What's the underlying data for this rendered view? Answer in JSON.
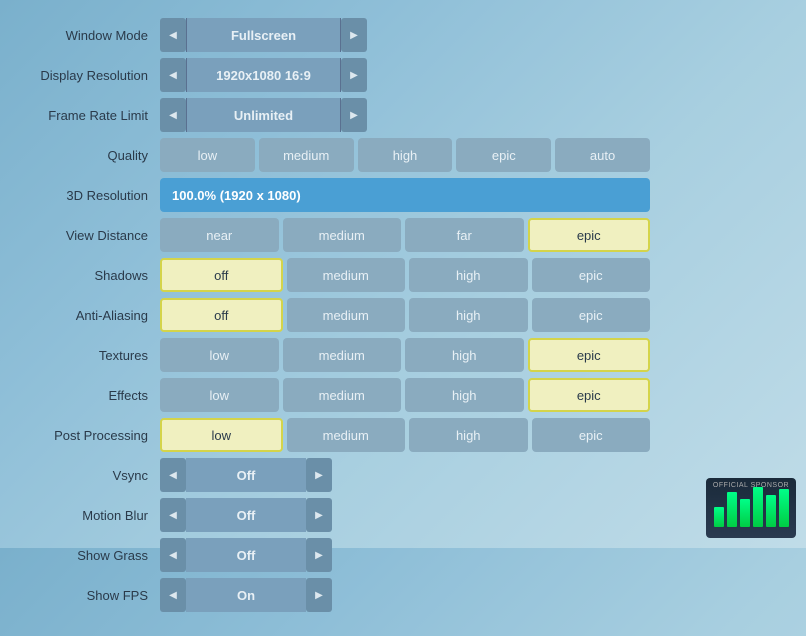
{
  "rows": {
    "window_mode": {
      "label": "Window Mode",
      "value": "Fullscreen"
    },
    "display_resolution": {
      "label": "Display Resolution",
      "value": "1920x1080 16:9"
    },
    "frame_rate_limit": {
      "label": "Frame Rate Limit",
      "value": "Unlimited"
    },
    "quality": {
      "label": "Quality",
      "buttons": [
        "low",
        "medium",
        "high",
        "epic",
        "auto"
      ]
    },
    "resolution_3d": {
      "label": "3D Resolution",
      "value": "100.0%  (1920 x 1080)"
    },
    "view_distance": {
      "label": "View Distance",
      "buttons": [
        "near",
        "medium",
        "far",
        "epic"
      ],
      "active": 3
    },
    "shadows": {
      "label": "Shadows",
      "buttons": [
        "off",
        "medium",
        "high",
        "epic"
      ],
      "active": 0
    },
    "anti_aliasing": {
      "label": "Anti-Aliasing",
      "buttons": [
        "off",
        "medium",
        "high",
        "epic"
      ],
      "active": 0
    },
    "textures": {
      "label": "Textures",
      "buttons": [
        "low",
        "medium",
        "high",
        "epic"
      ],
      "active": 3
    },
    "effects": {
      "label": "Effects",
      "buttons": [
        "low",
        "medium",
        "high",
        "epic"
      ],
      "active": 3
    },
    "post_processing": {
      "label": "Post Processing",
      "buttons": [
        "low",
        "medium",
        "high",
        "epic"
      ],
      "active": 0
    },
    "vsync": {
      "label": "Vsync",
      "value": "Off"
    },
    "motion_blur": {
      "label": "Motion Blur",
      "value": "Off"
    },
    "show_grass": {
      "label": "Show Grass",
      "value": "Off"
    },
    "show_fps": {
      "label": "Show FPS",
      "value": "On"
    }
  },
  "sponsor": {
    "text": "OFFICIAL SPONSOR",
    "bars": [
      20,
      35,
      28,
      40,
      32,
      38
    ]
  }
}
